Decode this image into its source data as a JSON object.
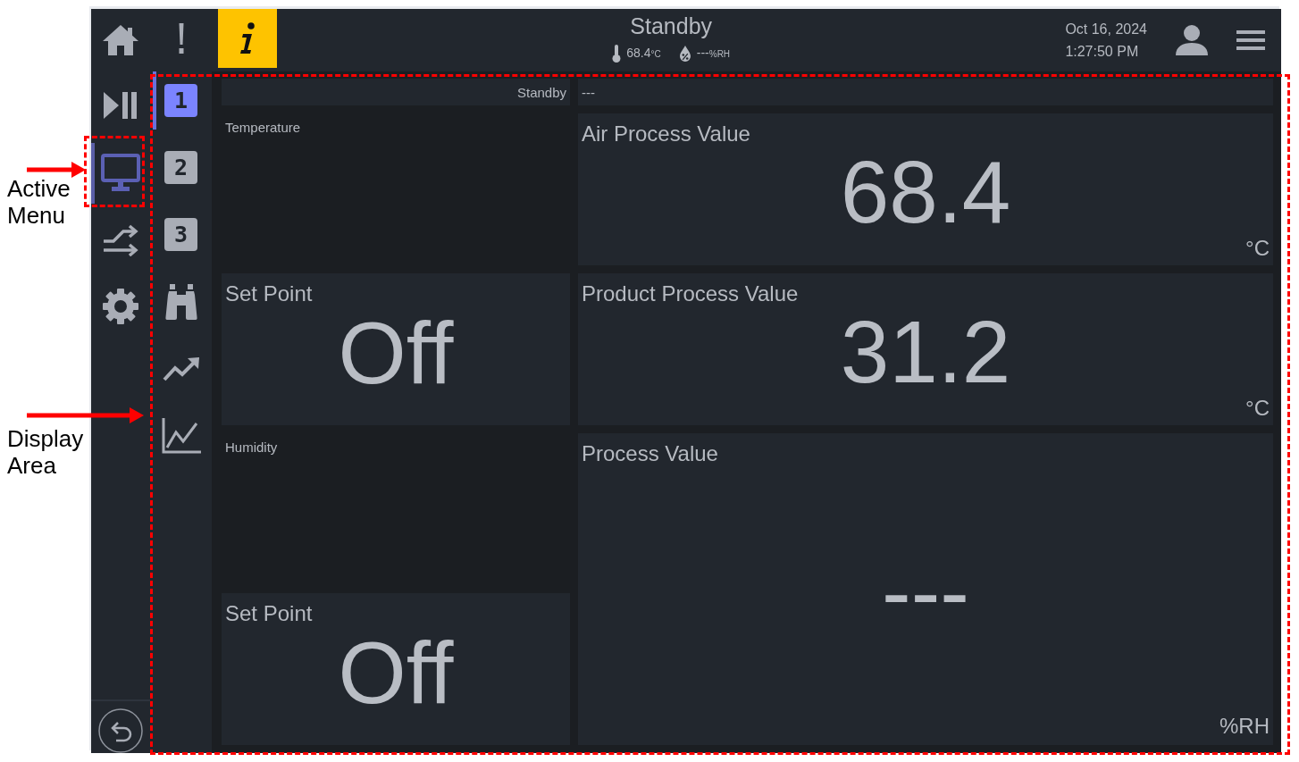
{
  "callouts": [
    {
      "label": "Active Menu"
    },
    {
      "label": "Display Area"
    }
  ],
  "nav": {
    "items": [
      {
        "kind": "home",
        "selected": false
      },
      {
        "kind": "play_pause",
        "selected": false
      },
      {
        "kind": "monitor",
        "selected": true
      },
      {
        "kind": "transfer",
        "selected": false
      },
      {
        "kind": "settings",
        "selected": false
      }
    ]
  },
  "header": {
    "indicators": [
      {
        "kind": "alert",
        "active": false
      },
      {
        "kind": "info",
        "active": true
      }
    ],
    "status": "Standby",
    "temperature": {
      "value": "68.4",
      "unit": "°C"
    },
    "humidity": {
      "value": "---",
      "unit": "%RH"
    },
    "date": "Oct 16, 2024",
    "time": "1:27:50 PM"
  },
  "tabs": [
    {
      "label": "1",
      "selected": true
    },
    {
      "label": "2",
      "selected": false
    },
    {
      "label": "3",
      "selected": false
    }
  ],
  "tools": [
    {
      "kind": "binoculars"
    },
    {
      "kind": "trend"
    },
    {
      "kind": "chart"
    }
  ],
  "display": {
    "status_row": {
      "status": "Standby",
      "value": "---"
    },
    "left": [
      {
        "kind": "heading",
        "label": "Temperature"
      },
      {
        "kind": "setpoint",
        "label": "Set Point",
        "value": "Off"
      },
      {
        "kind": "heading",
        "label": "Humidity"
      },
      {
        "kind": "setpoint",
        "label": "Set Point",
        "value": "Off"
      }
    ],
    "right": [
      {
        "label": "Air Process Value",
        "value": "68.4",
        "unit": "°C"
      },
      {
        "label": "Product Process Value",
        "value": "31.2",
        "unit": "°C"
      },
      {
        "label": "Process Value",
        "value": "---",
        "unit": "%RH"
      }
    ]
  }
}
